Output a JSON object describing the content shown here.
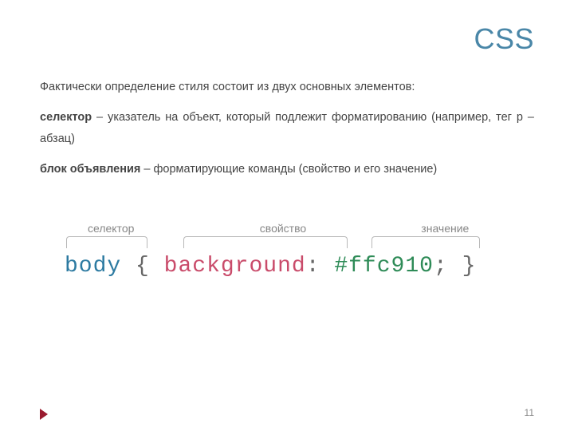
{
  "title": "CSS",
  "paragraphs": {
    "p1": "Фактически определение стиля состоит из двух основных элементов:",
    "p2_bold": "селектор",
    "p2_rest": " – указатель на объект, который подлежит форматированию (например, тег p – абзац)",
    "p3_bold": "блок объявления",
    "p3_rest": " – форматирующие команды (свойство и его значение)"
  },
  "diagram": {
    "labels": {
      "selector": "селектор",
      "property": "свойство",
      "value": "значение"
    },
    "code": {
      "selector": "body",
      "brace_open": "{",
      "property": "background",
      "colon": ":",
      "value": "#ffc910",
      "semicolon": ";",
      "brace_close": "}"
    }
  },
  "page_number": "11"
}
